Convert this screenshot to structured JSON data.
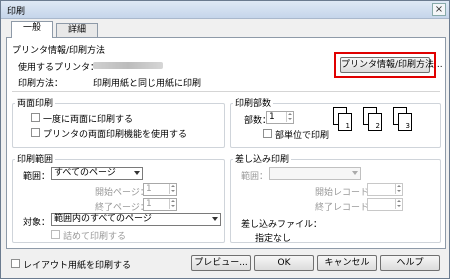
{
  "window": {
    "title": "印刷",
    "close": "×"
  },
  "tabs": [
    {
      "label": "一般"
    },
    {
      "label": "詳細"
    }
  ],
  "printer_info": {
    "group": "プリンタ情報/印刷方法",
    "printer_label": "使用するプリンタ：",
    "method_label": "印刷方法：",
    "method_value": "印刷用紙と同じ用紙に印刷",
    "button": "プリンタ情報/印刷方法..."
  },
  "duplex": {
    "group": "両面印刷",
    "opt1": "一度に両面に印刷する",
    "opt2": "プリンタの両面印刷機能を使用する"
  },
  "copies": {
    "group": "印刷部数",
    "label": "部数：",
    "value": "1",
    "collate": "部単位で印刷",
    "pages": [
      "1",
      "2",
      "3",
      "1",
      "2",
      "3"
    ]
  },
  "range": {
    "group": "印刷範囲",
    "range_label": "範囲：",
    "range_value": "すべてのページ",
    "start_label": "開始ページ：",
    "start_value": "1",
    "end_label": "終了ページ：",
    "end_value": "1",
    "target_label": "対象：",
    "target_value": "範囲内のすべてのページ",
    "compact": "詰めて印刷する"
  },
  "merge": {
    "group": "差し込み印刷",
    "range_label": "範囲：",
    "start_label": "開始レコード：",
    "end_label": "終了レコード：",
    "file_label": "差し込みファイル：",
    "file_value": "指定なし"
  },
  "footer": {
    "layout_paper": "レイアウト用紙を印刷する",
    "preview": "プレビュー...",
    "ok": "OK",
    "cancel": "キャンセル",
    "help": "ヘルプ"
  },
  "colors": {
    "highlight": "#e00000"
  }
}
